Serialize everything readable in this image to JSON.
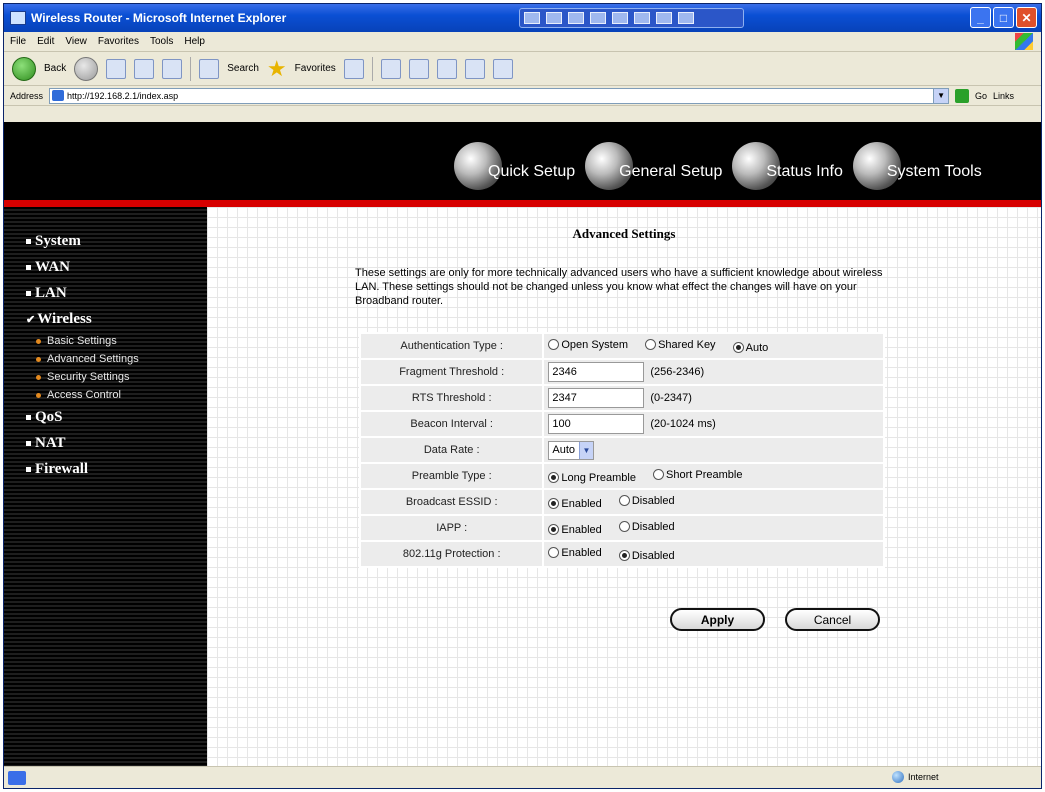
{
  "window": {
    "title": "Wireless Router - Microsoft Internet Explorer",
    "buttons": {
      "minimize": "_",
      "maximize": "□",
      "close": "✕"
    }
  },
  "menu": [
    "File",
    "Edit",
    "View",
    "Favorites",
    "Tools",
    "Help"
  ],
  "toolbar": {
    "back": "Back",
    "search": "Search",
    "favorites": "Favorites"
  },
  "address": {
    "label": "Address",
    "url": "http://192.168.2.1/index.asp",
    "go": "Go",
    "links": "Links"
  },
  "banner_nav": [
    {
      "label": "Quick Setup",
      "icon": "quick-setup-globe-icon"
    },
    {
      "label": "General Setup",
      "icon": "general-setup-globe-icon"
    },
    {
      "label": "Status Info",
      "icon": "status-info-globe-icon"
    },
    {
      "label": "System Tools",
      "icon": "system-tools-globe-icon"
    }
  ],
  "sidebar": {
    "items": [
      {
        "label": "System"
      },
      {
        "label": "WAN"
      },
      {
        "label": "LAN"
      },
      {
        "label": "Wireless",
        "checked": true
      }
    ],
    "wireless_sub": [
      "Basic Settings",
      "Advanced Settings",
      "Security Settings",
      "Access Control"
    ],
    "items_after": [
      {
        "label": "QoS"
      },
      {
        "label": "NAT"
      },
      {
        "label": "Firewall"
      }
    ]
  },
  "content": {
    "title": "Advanced Settings",
    "description": "These settings are only for more technically advanced users who have a sufficient knowledge about wireless LAN. These settings should not be changed unless you know what effect the changes will have on your Broadband router.",
    "rows": {
      "auth_type": {
        "label": "Authentication Type :",
        "options": [
          "Open System",
          "Shared Key",
          "Auto"
        ],
        "selected": "Auto"
      },
      "fragment": {
        "label": "Fragment Threshold :",
        "value": "2346",
        "range": "(256-2346)"
      },
      "rts": {
        "label": "RTS Threshold :",
        "value": "2347",
        "range": "(0-2347)"
      },
      "beacon": {
        "label": "Beacon Interval :",
        "value": "100",
        "range": "(20-1024 ms)"
      },
      "data_rate": {
        "label": "Data Rate :",
        "value": "Auto"
      },
      "preamble": {
        "label": "Preamble Type :",
        "options": [
          "Long Preamble",
          "Short Preamble"
        ],
        "selected": "Long Preamble"
      },
      "broadcast_essid": {
        "label": "Broadcast ESSID :",
        "options": [
          "Enabled",
          "Disabled"
        ],
        "selected": "Enabled"
      },
      "iapp": {
        "label": "IAPP :",
        "options": [
          "Enabled",
          "Disabled"
        ],
        "selected": "Enabled"
      },
      "protection": {
        "label": "802.11g Protection :",
        "options": [
          "Enabled",
          "Disabled"
        ],
        "selected": "Disabled"
      }
    },
    "apply_label": "Apply",
    "cancel_label": "Cancel"
  },
  "statusbar": {
    "zone": "Internet"
  },
  "colors": {
    "accent_red": "#d70000",
    "banner_bg": "#000000",
    "sub_bullet": "#e48a1f"
  }
}
